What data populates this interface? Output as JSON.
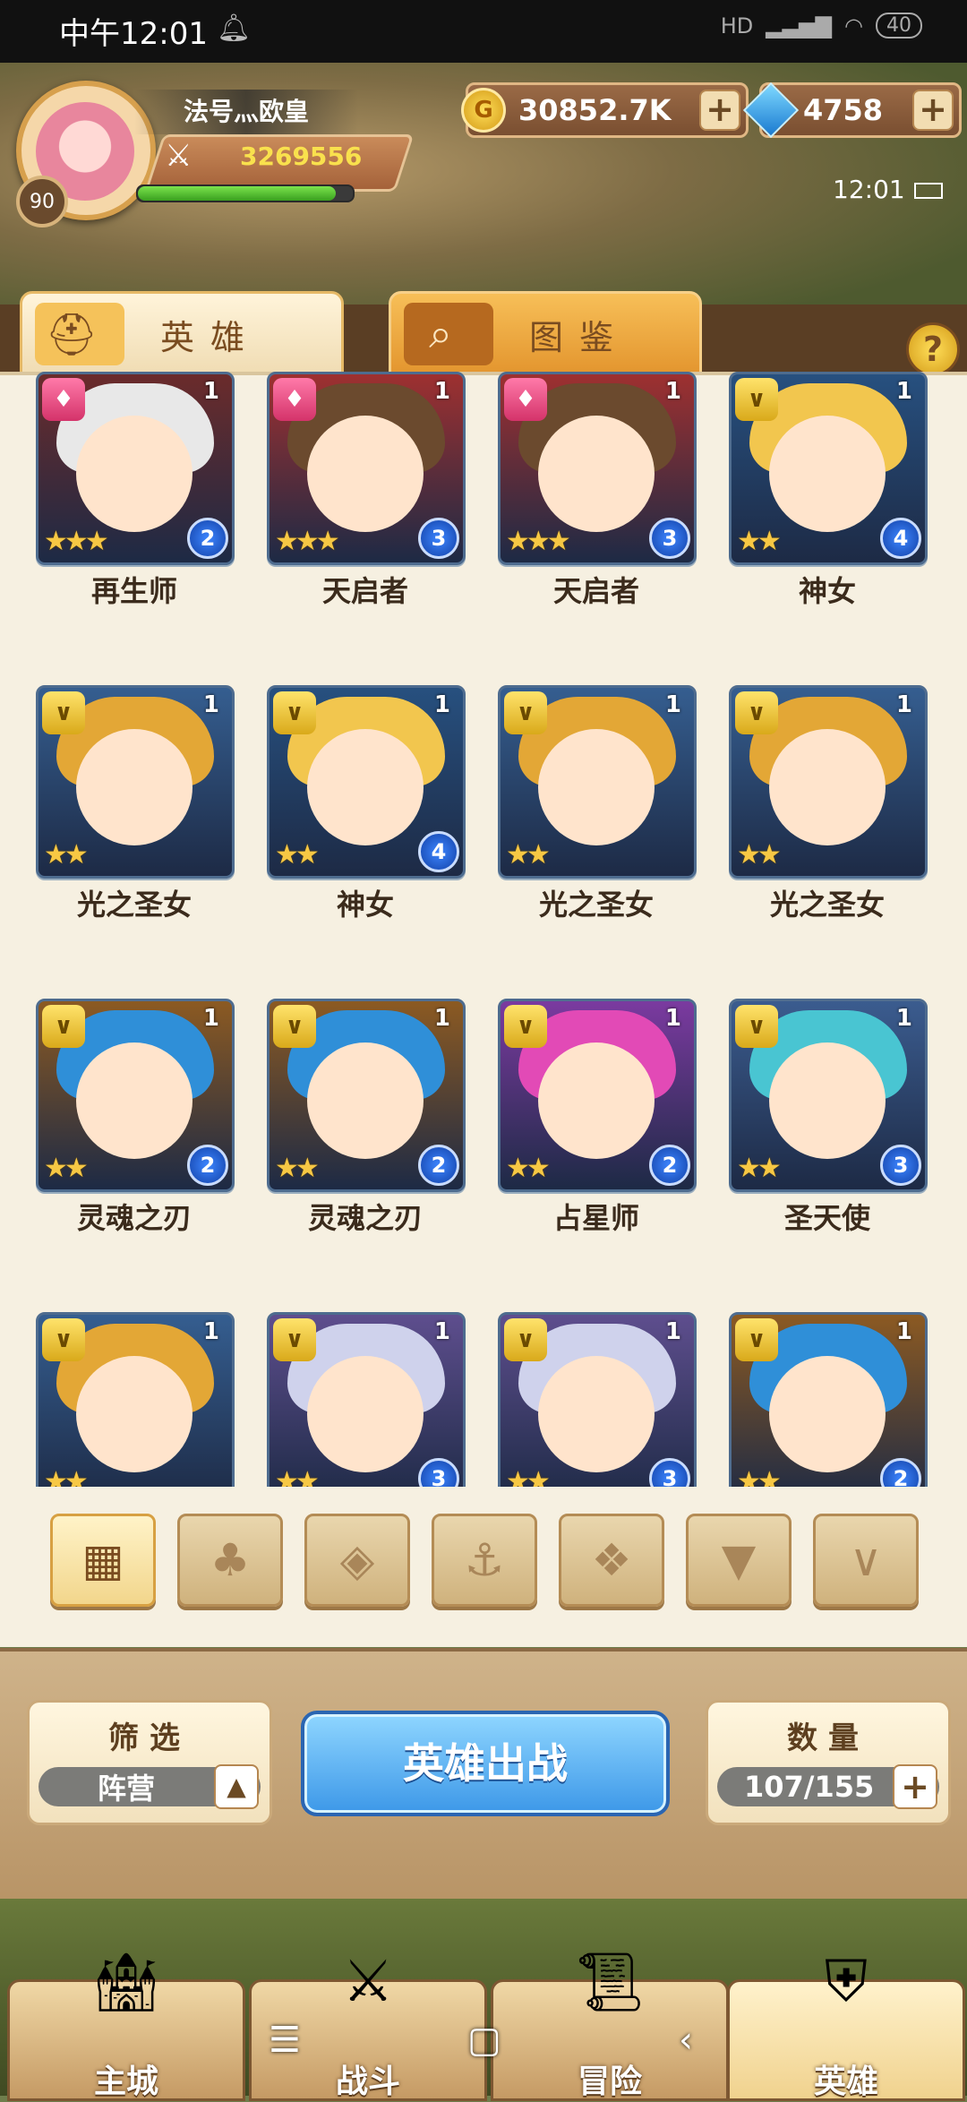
{
  "status_bar": {
    "time": "中午12:01",
    "signal_text": "HD",
    "battery": "40"
  },
  "player": {
    "name": "法号灬欧皇",
    "level": "90",
    "power": "3269556",
    "xp_fraction": 0.92
  },
  "resources": {
    "gold": "30852.7K",
    "gems": "4758"
  },
  "clock": "12:01",
  "tabs": {
    "hero": "英雄",
    "book": "图鉴"
  },
  "help_label": "?",
  "heroes": [
    {
      "name": "再生师",
      "faction": "fire",
      "stars": 3,
      "level": "2",
      "count": "1",
      "hair": "#e8e8e8",
      "bg": "#6b2b2b"
    },
    {
      "name": "天启者",
      "faction": "fire",
      "stars": 3,
      "level": "3",
      "count": "1",
      "hair": "#6b4a2e",
      "bg": "#9e3030"
    },
    {
      "name": "天启者",
      "faction": "fire",
      "stars": 3,
      "level": "3",
      "count": "1",
      "hair": "#6b4a2e",
      "bg": "#9e3030"
    },
    {
      "name": "神女",
      "faction": "light",
      "stars": 2,
      "level": "4",
      "count": "1",
      "hair": "#f2c64e",
      "bg": "#27507f"
    },
    {
      "name": "光之圣女",
      "faction": "light",
      "stars": 2,
      "level": "",
      "count": "1",
      "hair": "#e3a736",
      "bg": "#355e90"
    },
    {
      "name": "神女",
      "faction": "light",
      "stars": 2,
      "level": "4",
      "count": "1",
      "hair": "#f2c64e",
      "bg": "#27507f"
    },
    {
      "name": "光之圣女",
      "faction": "light",
      "stars": 2,
      "level": "",
      "count": "1",
      "hair": "#e3a736",
      "bg": "#355e90"
    },
    {
      "name": "光之圣女",
      "faction": "light",
      "stars": 2,
      "level": "",
      "count": "1",
      "hair": "#e3a736",
      "bg": "#355e90"
    },
    {
      "name": "灵魂之刃",
      "faction": "light",
      "stars": 2,
      "level": "2",
      "count": "1",
      "hair": "#2f8fd8",
      "bg": "#8c5a22"
    },
    {
      "name": "灵魂之刃",
      "faction": "light",
      "stars": 2,
      "level": "2",
      "count": "1",
      "hair": "#2f8fd8",
      "bg": "#8c5a22"
    },
    {
      "name": "占星师",
      "faction": "light",
      "stars": 2,
      "level": "2",
      "count": "1",
      "hair": "#e24ab6",
      "bg": "#7b3aa0"
    },
    {
      "name": "圣天使",
      "faction": "light",
      "stars": 2,
      "level": "3",
      "count": "1",
      "hair": "#49c5d2",
      "bg": "#3b5c8f"
    },
    {
      "name": "",
      "faction": "light",
      "stars": 2,
      "level": "",
      "count": "1",
      "hair": "#e3a736",
      "bg": "#355e90"
    },
    {
      "name": "",
      "faction": "light",
      "stars": 2,
      "level": "3",
      "count": "1",
      "hair": "#cfd2ec",
      "bg": "#5e4e8e"
    },
    {
      "name": "",
      "faction": "light",
      "stars": 2,
      "level": "3",
      "count": "1",
      "hair": "#cfd2ec",
      "bg": "#5e4e8e"
    },
    {
      "name": "",
      "faction": "light",
      "stars": 2,
      "level": "2",
      "count": "1",
      "hair": "#2f8fd8",
      "bg": "#8c5a22"
    }
  ],
  "filters": [
    {
      "name": "filter-all-button",
      "icon": "grid-icon",
      "glyph": "▦",
      "active": true
    },
    {
      "name": "filter-nature-button",
      "icon": "sprout-icon",
      "glyph": "♣",
      "active": false
    },
    {
      "name": "filter-water-button",
      "icon": "diamond-icon",
      "glyph": "◈",
      "active": false
    },
    {
      "name": "filter-sea-button",
      "icon": "anchor-icon",
      "glyph": "⚓",
      "active": false
    },
    {
      "name": "filter-beast-button",
      "icon": "beast-icon",
      "glyph": "❖",
      "active": false
    },
    {
      "name": "filter-dark-button",
      "icon": "dark-horn-icon",
      "glyph": "▼",
      "active": false
    },
    {
      "name": "filter-light-button",
      "icon": "light-wing-icon",
      "glyph": "∨",
      "active": false
    }
  ],
  "screen_filter": {
    "title": "筛选",
    "value": "阵营",
    "arrow": "▲"
  },
  "deploy_button": "英雄出战",
  "quantity": {
    "title": "数量",
    "value": "107/155",
    "plus": "+"
  },
  "nav": [
    {
      "label": "主城",
      "icon": "castle-icon"
    },
    {
      "label": "战斗",
      "icon": "crossed-swords-icon"
    },
    {
      "label": "冒险",
      "icon": "scroll-icon"
    },
    {
      "label": "英雄",
      "icon": "hero-helmet-icon"
    }
  ],
  "system_keys": {
    "menu": "☰",
    "home": "▢",
    "back": "‹"
  },
  "colors": {
    "panel_bg": "#f6f0e1",
    "gold": "#ffde59",
    "deploy_blue": "#3d98e8"
  }
}
